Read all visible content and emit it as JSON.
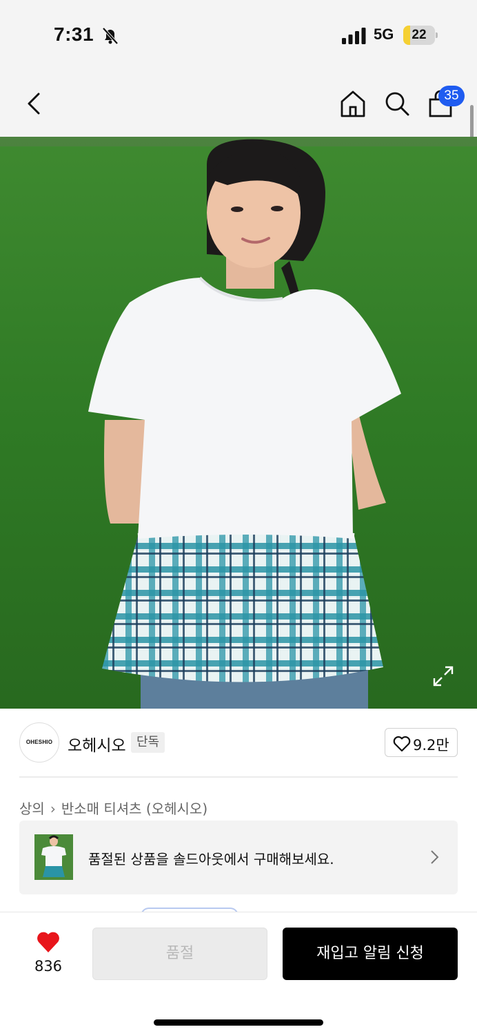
{
  "status_bar": {
    "time": "7:31",
    "network": "5G",
    "battery_level": "22",
    "battery_fraction": 0.22,
    "icons": [
      "bell-off-icon",
      "signal-icon",
      "battery-icon"
    ]
  },
  "nav": {
    "icons": [
      "back-icon",
      "home-icon",
      "search-icon",
      "cart-icon"
    ],
    "cart_count": "35"
  },
  "photo": {
    "icons": [
      "expand-icon"
    ]
  },
  "brand": {
    "logo_text": "OHESHIO",
    "name": "오헤시오",
    "tag": "단독",
    "like_count": "9.2만"
  },
  "breadcrumb": {
    "level1": "상의",
    "level2": "반소매 티셔츠 (오헤시오)"
  },
  "soldout_banner": {
    "text": "품절된 상품을 솔드아웃에서 구매해보세요."
  },
  "actions": {
    "wish_count": "836",
    "soldout_label": "품절",
    "restock_label": "재입고 알림 신청"
  },
  "colors": {
    "accent_badge": "#1f5cf0",
    "heart_red": "#e8151b",
    "primary_button": "#000000",
    "disabled_button": "#ebebeb"
  }
}
